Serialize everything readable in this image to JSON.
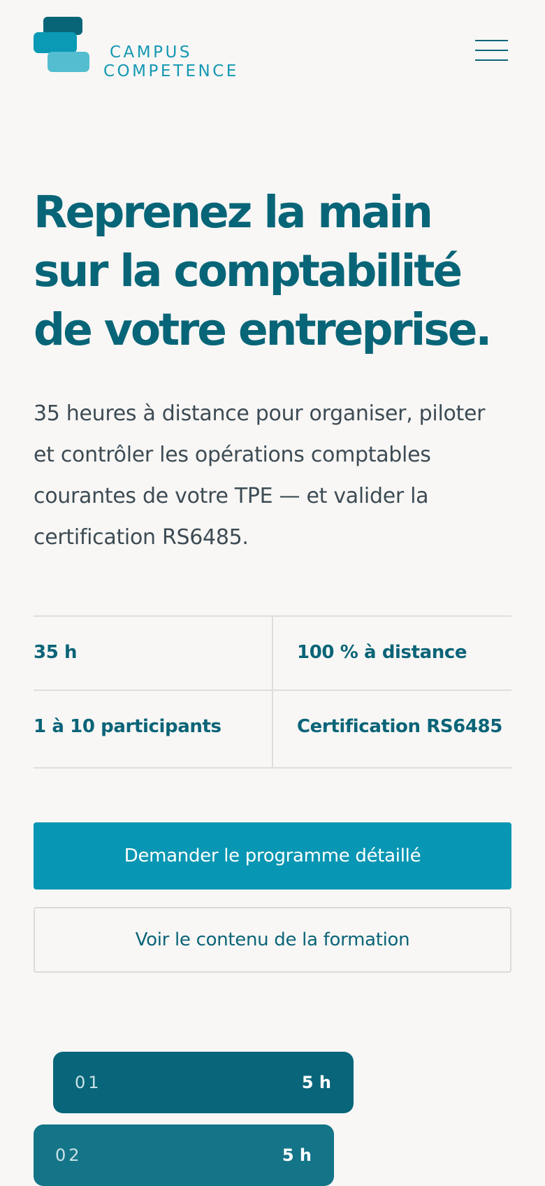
{
  "brand": {
    "line1": "CAMPUS",
    "line2": "COMPETENCE",
    "logo_icon": "stacked-bars-logo",
    "colors": {
      "dark": "#086578",
      "mid": "#0a9ab5",
      "light": "#54bdd0"
    }
  },
  "header": {
    "menu_icon": "hamburger-menu-icon"
  },
  "hero": {
    "title_line1": "Reprenez la main",
    "title_line2": "sur la comptabilité",
    "title_line3": "de votre entreprise.",
    "lead_line1": "35 heures à distance pour organiser, piloter",
    "lead_line2": "et contrôler les opérations comptables",
    "lead_line3": "courantes de votre TPE — et valider la",
    "lead_line4": "certification RS6485."
  },
  "facts": [
    "35 h",
    "100 % à distance",
    "1 à 10 participants",
    "Certification RS6485"
  ],
  "cta": {
    "primary": "Demander le programme détaillé",
    "secondary": "Voir le contenu de la formation"
  },
  "modules": [
    {
      "number": "01",
      "duration": "5 h"
    },
    {
      "number": "02",
      "duration": "5 h"
    }
  ],
  "theme": {
    "background": "#f8f7f5",
    "accent": "#0796b3",
    "heading": "#086578"
  }
}
